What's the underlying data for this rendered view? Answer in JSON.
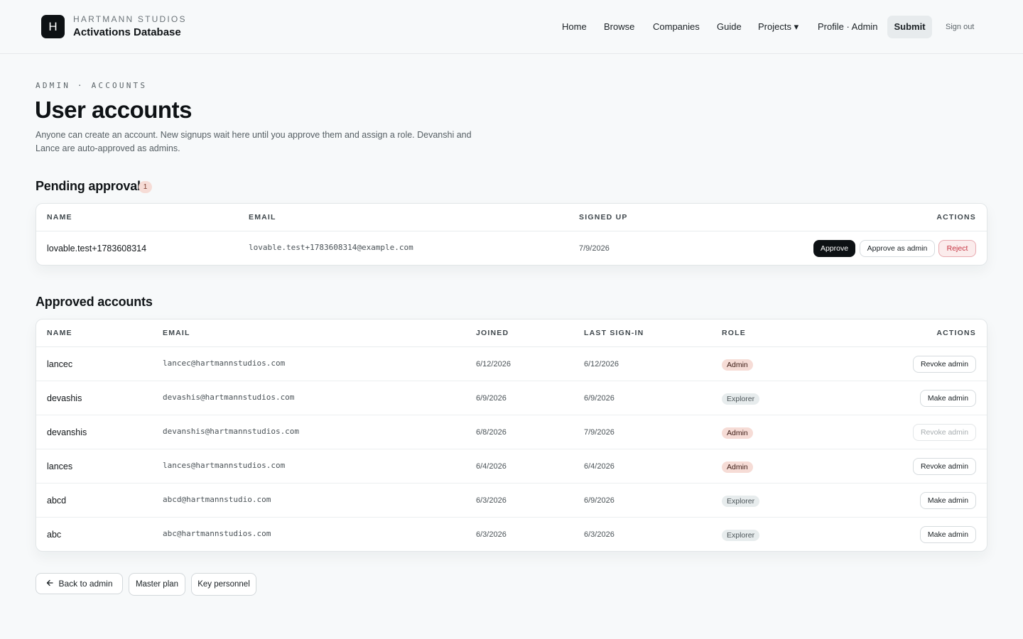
{
  "header": {
    "logo_letter": "H",
    "brand_top": "HARTMANN STUDIOS",
    "brand_main": "Activations Database",
    "nav": {
      "home": "Home",
      "browse": "Browse",
      "companies": "Companies",
      "guide": "Guide",
      "projects": "Projects ▾",
      "profile": "Profile · Admin",
      "submit": "Submit",
      "signout": "Sign out"
    }
  },
  "intro": {
    "eyebrow": "ADMIN · ACCOUNTS",
    "title": "User accounts",
    "description": "Anyone can create an account. New signups wait here until you approve them and assign a role. Devanshi and Lance are auto-approved as admins."
  },
  "pending": {
    "title": "Pending approval",
    "count": "1",
    "columns": {
      "name": "NAME",
      "email": "EMAIL",
      "signed_up": "SIGNED UP",
      "actions": "ACTIONS"
    },
    "rows": [
      {
        "name": "lovable.test+1783608314",
        "email": "lovable.test+1783608314@example.com",
        "signed_up": "7/9/2026",
        "approve": "Approve",
        "approve_admin": "Approve as admin",
        "reject": "Reject"
      }
    ]
  },
  "approved": {
    "title": "Approved accounts",
    "columns": {
      "name": "NAME",
      "email": "EMAIL",
      "joined": "JOINED",
      "last": "LAST SIGN-IN",
      "role": "ROLE",
      "actions": "ACTIONS"
    },
    "rows": [
      {
        "name": "lancec",
        "email": "lancec@hartmannstudios.com",
        "joined": "6/12/2026",
        "last": "6/12/2026",
        "role": "Admin",
        "action": "Revoke admin"
      },
      {
        "name": "devashis",
        "email": "devashis@hartmannstudios.com",
        "joined": "6/9/2026",
        "last": "6/9/2026",
        "role": "Explorer",
        "action": "Make admin"
      },
      {
        "name": "devanshis",
        "email": "devanshis@hartmannstudios.com",
        "joined": "6/8/2026",
        "last": "7/9/2026",
        "role": "Admin",
        "action": "Revoke admin"
      },
      {
        "name": "lances",
        "email": "lances@hartmannstudios.com",
        "joined": "6/4/2026",
        "last": "6/4/2026",
        "role": "Admin",
        "action": "Revoke admin"
      },
      {
        "name": "abcd",
        "email": "abcd@hartmannstudio.com",
        "joined": "6/3/2026",
        "last": "6/9/2026",
        "role": "Explorer",
        "action": "Make admin"
      },
      {
        "name": "abc",
        "email": "abc@hartmannstudios.com",
        "joined": "6/3/2026",
        "last": "6/3/2026",
        "role": "Explorer",
        "action": "Make admin"
      }
    ]
  },
  "footer": {
    "back": "Back to admin",
    "master_plan": "Master plan",
    "key_personnel": "Key personnel"
  },
  "icons": {
    "back": "arrow-left-icon"
  },
  "colors": {
    "primary": "#0d1114",
    "admin_badge": "#f6dcd6",
    "explorer_badge": "#e7eced",
    "danger": "#c5323f"
  }
}
